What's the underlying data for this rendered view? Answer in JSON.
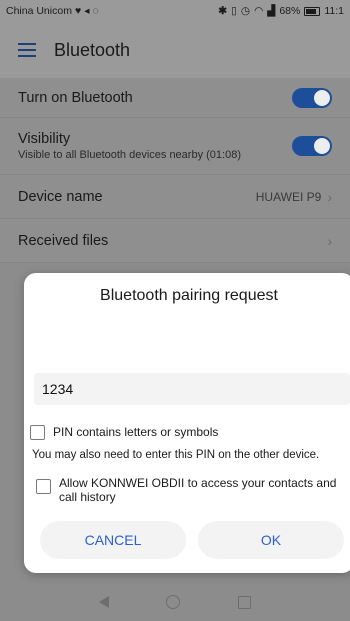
{
  "status_bar": {
    "carrier": "China Unicom",
    "battery": "68%",
    "time": "11:1"
  },
  "app_bar": {
    "title": "Bluetooth"
  },
  "settings": [
    {
      "label": "Turn on Bluetooth",
      "toggle": "on"
    },
    {
      "label": "Visibility",
      "sub": "Visible to all Bluetooth devices nearby (01:08)",
      "toggle": "on"
    },
    {
      "label": "Device name",
      "value": "HUAWEI P9"
    },
    {
      "label": "Received files"
    }
  ],
  "dialog": {
    "title": "Bluetooth pairing request",
    "pin_value": "1234",
    "pin_letters_label": "PIN contains letters or symbols",
    "hint": "You may also need to enter this PIN on the other device.",
    "allow_label": "Allow KONNWEI OBDII to access your contacts and call history",
    "cancel_label": "CANCEL",
    "ok_label": "OK"
  },
  "colors": {
    "accent": "#2e5fd1",
    "toggle": "#1d4e9a"
  }
}
